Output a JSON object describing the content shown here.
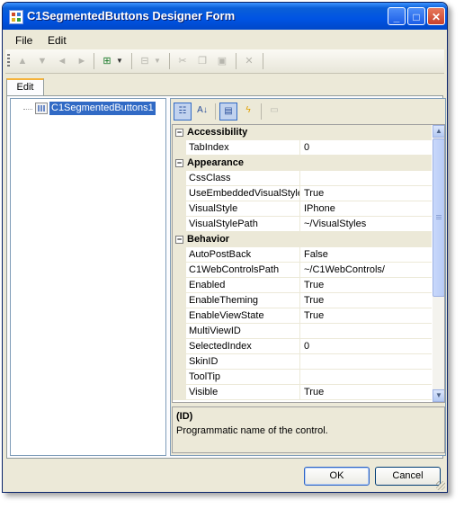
{
  "window": {
    "title": "C1SegmentedButtons Designer Form"
  },
  "menu": [
    "File",
    "Edit"
  ],
  "tab": {
    "label": "Edit"
  },
  "tree": {
    "root_label": "C1SegmentedButtons1"
  },
  "categories": {
    "accessibility": "Accessibility",
    "appearance": "Appearance",
    "behavior": "Behavior"
  },
  "properties": {
    "accessibility": [
      {
        "name": "TabIndex",
        "value": "0"
      }
    ],
    "appearance": [
      {
        "name": "CssClass",
        "value": ""
      },
      {
        "name": "UseEmbeddedVisualStyles",
        "value": "True"
      },
      {
        "name": "VisualStyle",
        "value": "IPhone"
      },
      {
        "name": "VisualStylePath",
        "value": "~/VisualStyles"
      }
    ],
    "behavior": [
      {
        "name": "AutoPostBack",
        "value": "False"
      },
      {
        "name": "C1WebControlsPath",
        "value": "~/C1WebControls/"
      },
      {
        "name": "Enabled",
        "value": "True"
      },
      {
        "name": "EnableTheming",
        "value": "True"
      },
      {
        "name": "EnableViewState",
        "value": "True"
      },
      {
        "name": "MultiViewID",
        "value": ""
      },
      {
        "name": "SelectedIndex",
        "value": "0"
      },
      {
        "name": "SkinID",
        "value": ""
      },
      {
        "name": "ToolTip",
        "value": ""
      },
      {
        "name": "Visible",
        "value": "True"
      }
    ]
  },
  "help": {
    "title": "(ID)",
    "description": "Programmatic name of the control."
  },
  "buttons": {
    "ok": "OK",
    "cancel": "Cancel"
  }
}
